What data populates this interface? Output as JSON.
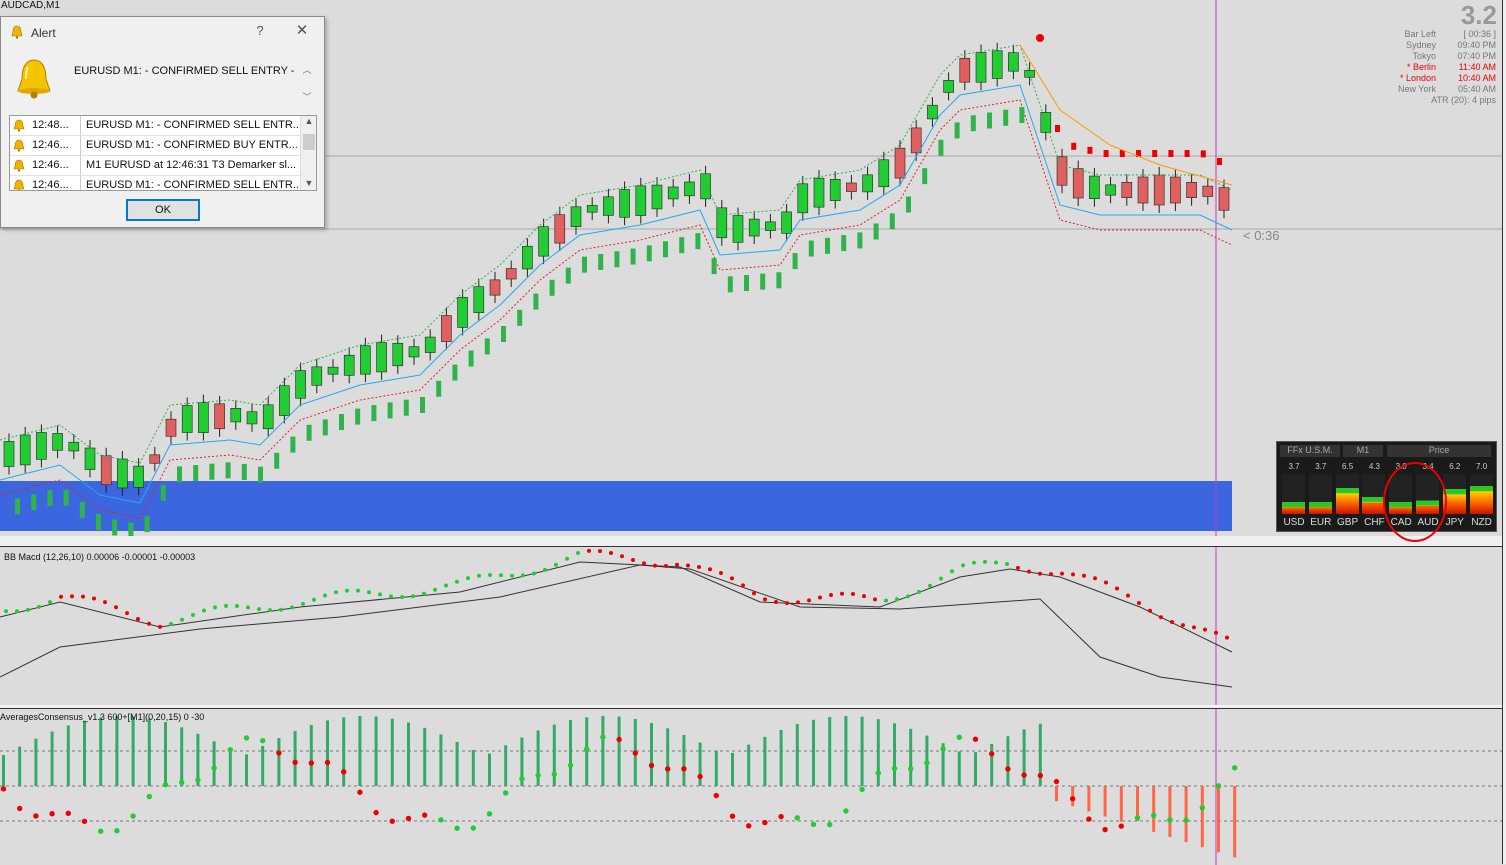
{
  "chart": {
    "symbol": "AUDCAD,M1",
    "countdown": "< 0:36",
    "macd_label": "BB Macd (12,26,10) 0.00006 -0.00001 -0.00003",
    "consensus_label": "AveragesConsensus_v1.3 600+[M1](0,20,15) 0 -30"
  },
  "chart_data": [
    {
      "type": "candlestick",
      "title": "AUDCAD,M1",
      "note": "price candles; values not printed on screen",
      "colors": {
        "up": "#22cc33",
        "down": "#e06060",
        "upper_band": "#dd2222",
        "lower_band": "#2fb34a",
        "ma_fast": "#22aaee",
        "ma_slow": "#ff9900",
        "highlight_zone": "#3366dd",
        "cursor_line": "#cc33cc"
      }
    },
    {
      "type": "line",
      "title": "BB Macd (12,26,10) 0.00006 -0.00001 -0.00003",
      "colors": {
        "up_dots": "#22cc33",
        "down_dots": "#ee0000",
        "lines": "#333333"
      }
    },
    {
      "type": "bar",
      "title": "AveragesConsensus_v1.3 600+[M1](0,20,15) 0 -30",
      "colors": {
        "positive": "#33aa66",
        "negative": "#ff6644"
      }
    }
  ],
  "alert": {
    "title": "Alert",
    "help": "?",
    "close": "✕",
    "message": "EURUSD M1:  -  CONFIRMED SELL ENTRY  -",
    "ok": "OK",
    "rows": [
      {
        "time": "12:48...",
        "msg": "EURUSD M1:  -  CONFIRMED SELL ENTR..."
      },
      {
        "time": "12:46...",
        "msg": "EURUSD M1:  -  CONFIRMED BUY ENTR..."
      },
      {
        "time": "12:46...",
        "msg": "M1 EURUSD at 12:46:31 T3 Demarker  sl..."
      },
      {
        "time": "12:46...",
        "msg": "EURUSD M1:  -  CONFIRMED SELL ENTR..."
      }
    ]
  },
  "clock": {
    "big": "3.2",
    "rows": [
      {
        "label": "Bar Left",
        "value": "[ 00:36 ]",
        "highlight": false
      },
      {
        "label": "Sydney",
        "value": "09:40 PM",
        "highlight": false
      },
      {
        "label": "Tokyo",
        "value": "07:40 PM",
        "highlight": false
      },
      {
        "label": "* Berlin",
        "value": "11:40 AM",
        "highlight": true
      },
      {
        "label": "* London",
        "value": "10:40 AM",
        "highlight": true
      },
      {
        "label": "New York",
        "value": "05:40 AM",
        "highlight": false
      }
    ],
    "atr": "ATR (20): 4 pips"
  },
  "ffx": {
    "title": "FFx U.S.M.",
    "timeframe": "M1",
    "mode": "Price",
    "values": [
      "3.7",
      "3.7",
      "6.5",
      "4.3",
      "3.0",
      "3.4",
      "6.2",
      "7.0"
    ],
    "currencies": [
      "USD",
      "EUR",
      "GBP",
      "CHF",
      "CAD",
      "AUD",
      "JPY",
      "NZD"
    ],
    "strength_levels": [
      0.3,
      0.3,
      0.65,
      0.43,
      0.3,
      0.34,
      0.62,
      0.7
    ]
  }
}
